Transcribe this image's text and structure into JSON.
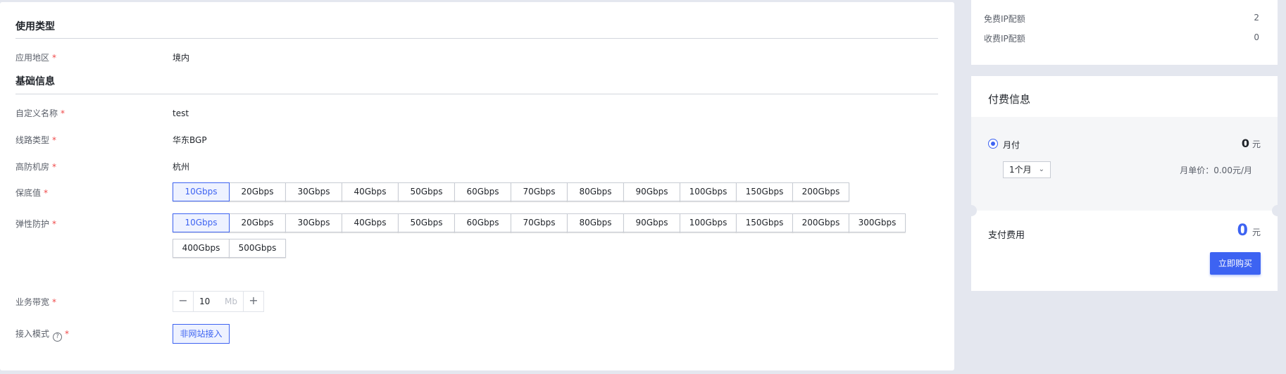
{
  "usage_section": {
    "title": "使用类型",
    "region_label": "应用地区",
    "region_value": "境内"
  },
  "basic_section": {
    "title": "基础信息",
    "fields": [
      {
        "label": "自定义名称",
        "value": "test"
      },
      {
        "label": "线路类型",
        "value": "华东BGP"
      },
      {
        "label": "高防机房",
        "value": "杭州"
      }
    ],
    "required_mark": "*"
  },
  "guarantee": {
    "label": "保底值",
    "options": [
      "10Gbps",
      "20Gbps",
      "30Gbps",
      "40Gbps",
      "50Gbps",
      "60Gbps",
      "70Gbps",
      "80Gbps",
      "90Gbps",
      "100Gbps",
      "150Gbps",
      "200Gbps"
    ],
    "selected": "10Gbps"
  },
  "elastic": {
    "label": "弹性防护",
    "options": [
      "10Gbps",
      "20Gbps",
      "30Gbps",
      "40Gbps",
      "50Gbps",
      "60Gbps",
      "70Gbps",
      "80Gbps",
      "90Gbps",
      "100Gbps",
      "150Gbps",
      "200Gbps",
      "300Gbps",
      "400Gbps",
      "500Gbps"
    ],
    "selected": "10Gbps"
  },
  "bandwidth": {
    "label": "业务带宽",
    "value": "10",
    "unit": "Mb",
    "minus": "−",
    "plus": "+"
  },
  "access_mode": {
    "label": "接入模式",
    "help_icon": "?",
    "option": "非网站接入"
  },
  "quota": {
    "free_label": "免费IP配额",
    "free_value": "2",
    "paid_label": "收费IP配额",
    "paid_value": "0"
  },
  "payment": {
    "title": "付费信息",
    "method": "月付",
    "price": "0",
    "currency": "元",
    "duration": "1个月",
    "unit_price": "月单价：0.00元/月",
    "total_label": "支付费用",
    "total_value": "0",
    "total_currency": "元",
    "buy_label": "立即购买"
  },
  "colors": {
    "accent": "#3d63f2",
    "required": "#f04a4a"
  }
}
